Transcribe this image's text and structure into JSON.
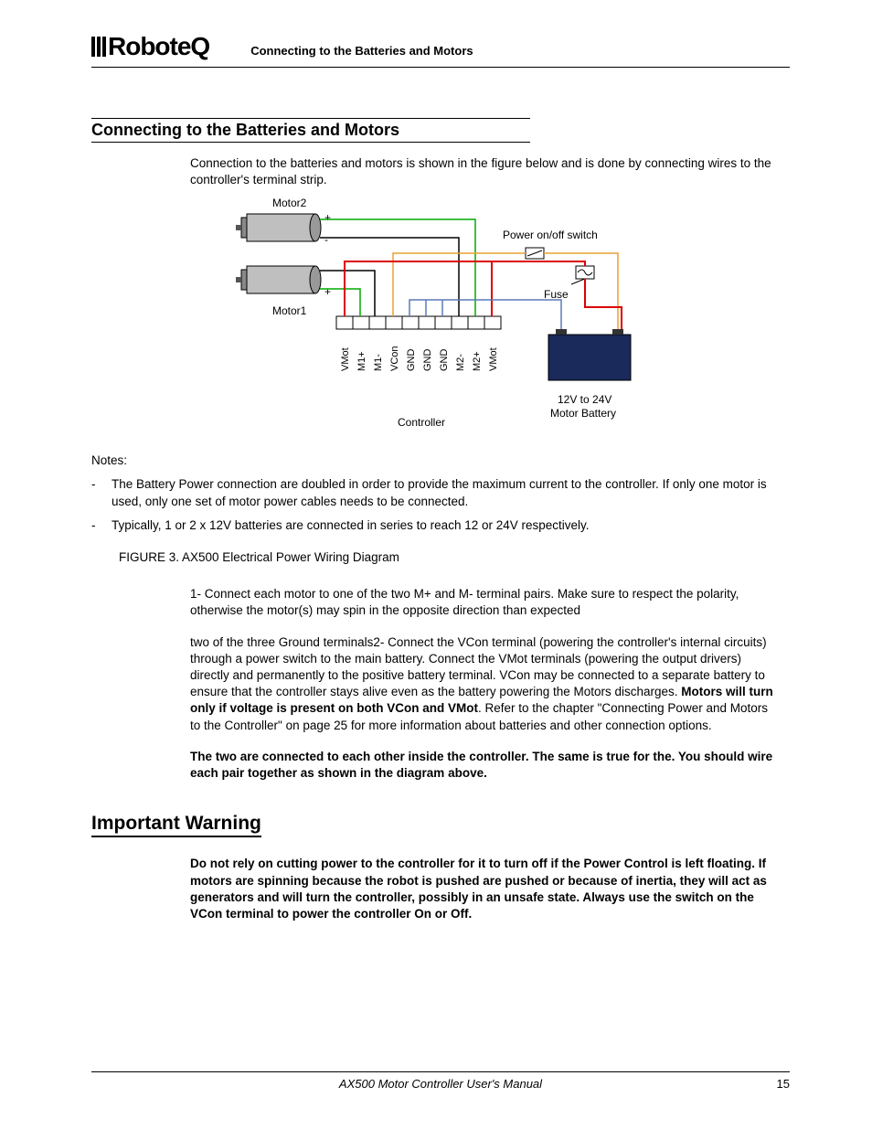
{
  "logo_text": "RoboteQ",
  "header_title": "Connecting to the Batteries and Motors",
  "section_title": "Connecting to the Batteries and Motors",
  "intro": "Connection to the batteries and motors is shown in the figure below and is done by connecting wires to the controller's terminal strip.",
  "diagram": {
    "motor2": "Motor2",
    "motor1": "Motor1",
    "switch": "Power on/off switch",
    "fuse": "Fuse",
    "battery": "12V to 24V\nMotor Battery",
    "controller": "Controller",
    "terminals": [
      "VMot",
      "M1+",
      "M1-",
      "VCon",
      "GND",
      "GND",
      "GND",
      "M2-",
      "M2+",
      "VMot"
    ],
    "plus": "+",
    "minus": "-"
  },
  "notes_label": "Notes:",
  "notes": [
    "The Battery Power connection are doubled in order to provide the maximum current to the controller. If only one motor is used, only one set of motor power cables needs to be connected.",
    "Typically, 1 or 2 x 12V batteries are connected in series to reach 12 or 24V respectively."
  ],
  "figure_caption": "FIGURE 3.  AX500 Electrical Power Wiring Diagram",
  "para1_a": "1- Connect each motor to one of the two M+ and M- terminal pairs. Make sure to respect the polarity, otherwise the motor(s) may spin in the opposite direction than expected",
  "para2_a": " two of the three Ground terminals2- Connect the VCon terminal (powering the controller's internal circuits) through a power switch to the main battery. Connect the VMot terminals (powering the output drivers) directly and permanently to the positive battery terminal. VCon may be connected to a separate battery to ensure that the controller stays alive even as the battery powering the Motors discharges. ",
  "para2_b": "Motors will turn only if voltage is present on both VCon and VMot",
  "para2_c": ". Refer to the chapter \"Connecting Power and Motors to the Controller\" on page 25 for more information about batteries and other connection options.",
  "para3": "The two are connected to each other inside the controller. The same is true for the. You should wire each pair together as shown in the diagram above.",
  "warning_title": "Important Warning",
  "warning_text": "Do not rely on cutting power to the controller for it to turn off if the Power Control is left floating. If motors are spinning because the robot is pushed are pushed or because of inertia, they will act as generators and will turn the controller, possibly in an unsafe state. Always use the switch on the VCon terminal to power the controller On or Off.",
  "footer_title": "AX500 Motor Controller User's Manual",
  "page_number": "15"
}
